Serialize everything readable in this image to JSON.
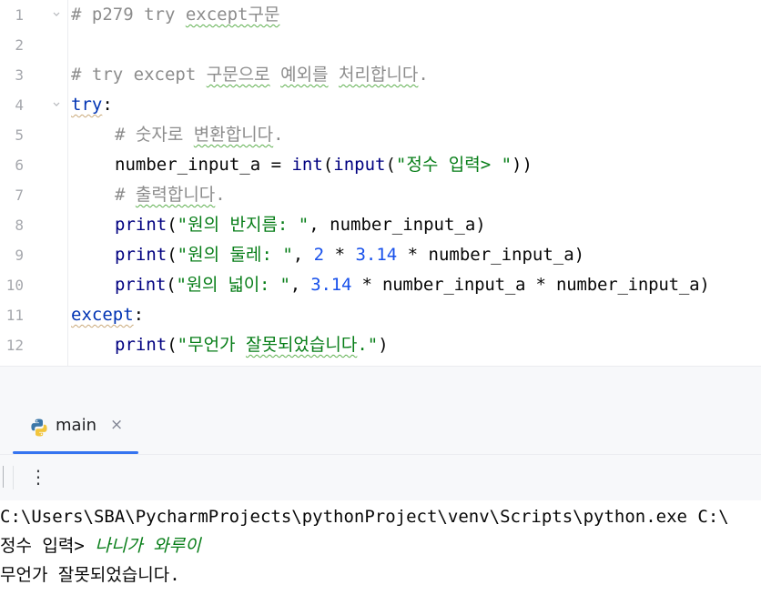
{
  "editor": {
    "lines": [
      {
        "n": "1",
        "t": "# p279 try except구문"
      },
      {
        "n": "2",
        "t": ""
      },
      {
        "n": "3",
        "t": "# try except 구문으로 예외를 처리합니다."
      },
      {
        "n": "4",
        "t": "try:"
      },
      {
        "n": "5",
        "t": "    # 숫자로 변환합니다."
      },
      {
        "n": "6",
        "t": "    number_input_a = int(input(\"정수 입력> \"))"
      },
      {
        "n": "7",
        "t": "    # 출력합니다."
      },
      {
        "n": "8",
        "t": "    print(\"원의 반지름: \", number_input_a)"
      },
      {
        "n": "9",
        "t": "    print(\"원의 둘레: \", 2 * 3.14 * number_input_a)"
      },
      {
        "n": "10",
        "t": "    print(\"원의 넓이: \", 3.14 * number_input_a * number_input_a)"
      },
      {
        "n": "11",
        "t": "except:"
      },
      {
        "n": "12",
        "t": "    print(\"무언가 잘못되었습니다.\")"
      }
    ]
  },
  "run_panel": {
    "tab_label": "main",
    "tab_close": "×",
    "more_icon": "⋮"
  },
  "console": {
    "command": "C:\\Users\\SBA\\PycharmProjects\\pythonProject\\venv\\Scripts\\python.exe C:\\",
    "prompt": "정수 입력> ",
    "user_input": "나니가 와루이",
    "output": "무언가 잘못되었습니다."
  },
  "colors": {
    "keyword": "#0033b3",
    "comment": "#8c8c8c",
    "string": "#067d17",
    "number": "#1750eb",
    "accent": "#3574f0"
  }
}
